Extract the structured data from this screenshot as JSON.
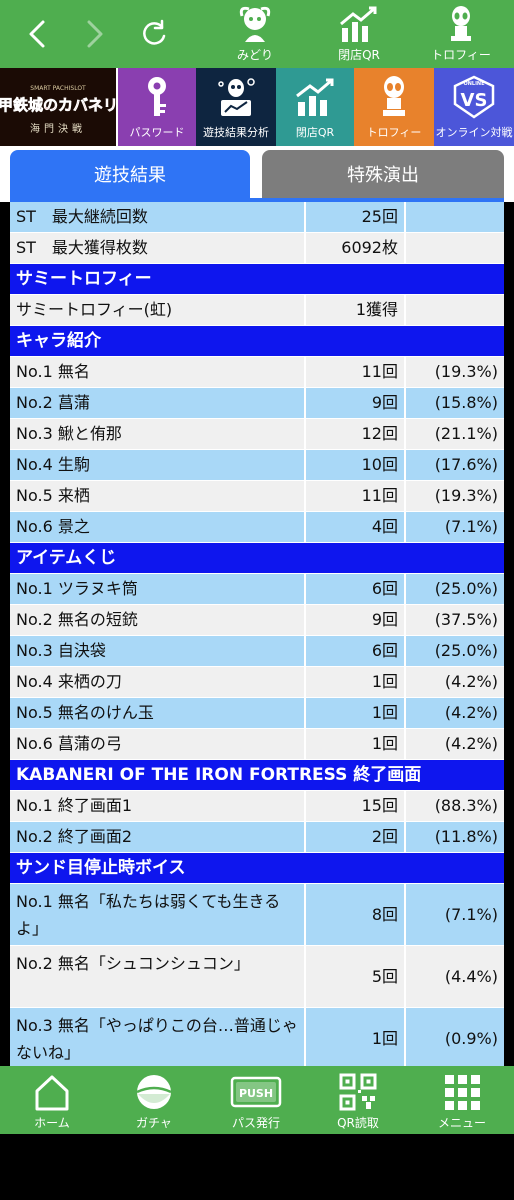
{
  "topbar": {
    "back_icon": "chevron-left-icon",
    "forward_icon": "chevron-right-icon",
    "reload_icon": "reload-icon",
    "items": [
      {
        "label": "みどり",
        "icon": "character-icon"
      },
      {
        "label": "閉店QR",
        "icon": "chart-up-icon"
      },
      {
        "label": "トロフィー",
        "icon": "alien-trophy-icon"
      }
    ]
  },
  "tiles": {
    "logo": {
      "title": "甲鉄城のカバネリ",
      "sub": "海門決戦",
      "small": "SMART PACHISLOT"
    },
    "items": [
      {
        "label": "パスワード",
        "color": "#8a3fb0",
        "icon": "key-icon"
      },
      {
        "label": "遊技結果分析",
        "color": "#0e2540",
        "icon": "analysis-icon"
      },
      {
        "label": "閉店QR",
        "color": "#2f9a93",
        "icon": "chart-up-icon"
      },
      {
        "label": "トロフィー",
        "color": "#e8822c",
        "icon": "alien-trophy-icon"
      },
      {
        "label": "オンライン対戦",
        "color": "#4c56d9",
        "icon": "vs-icon",
        "badge": "ONLINE",
        "badge_text": "VS"
      }
    ]
  },
  "tabs": {
    "active": "遊技結果",
    "inactive": "特殊演出"
  },
  "rows_top": [
    {
      "name": "ST　最大継続回数",
      "value": "25回",
      "pct": "",
      "style": "blue"
    },
    {
      "name": "ST　最大獲得枚数",
      "value": "6092枚",
      "pct": "",
      "style": "gray"
    }
  ],
  "sections": [
    {
      "title": "サミートロフィー",
      "rows": [
        {
          "name": "サミートロフィー(虹)",
          "value": "1獲得",
          "pct": "",
          "style": "gray"
        }
      ]
    },
    {
      "title": "キャラ紹介",
      "rows": [
        {
          "name": "No.1 無名",
          "value": "11回",
          "pct": "(19.3%)",
          "style": "gray"
        },
        {
          "name": "No.2 菖蒲",
          "value": "9回",
          "pct": "(15.8%)",
          "style": "blue"
        },
        {
          "name": "No.3 鰍と侑那",
          "value": "12回",
          "pct": "(21.1%)",
          "style": "gray"
        },
        {
          "name": "No.4 生駒",
          "value": "10回",
          "pct": "(17.6%)",
          "style": "blue"
        },
        {
          "name": "No.5 来栖",
          "value": "11回",
          "pct": "(19.3%)",
          "style": "gray"
        },
        {
          "name": "No.6 景之",
          "value": "4回",
          "pct": "(7.1%)",
          "style": "blue"
        }
      ]
    },
    {
      "title": "アイテムくじ",
      "rows": [
        {
          "name": "No.1 ツラヌキ筒",
          "value": "6回",
          "pct": "(25.0%)",
          "style": "blue"
        },
        {
          "name": "No.2 無名の短銃",
          "value": "9回",
          "pct": "(37.5%)",
          "style": "gray"
        },
        {
          "name": "No.3 自決袋",
          "value": "6回",
          "pct": "(25.0%)",
          "style": "blue"
        },
        {
          "name": "No.4 来栖の刀",
          "value": "1回",
          "pct": "(4.2%)",
          "style": "gray"
        },
        {
          "name": "No.5 無名のけん玉",
          "value": "1回",
          "pct": "(4.2%)",
          "style": "blue"
        },
        {
          "name": "No.6 菖蒲の弓",
          "value": "1回",
          "pct": "(4.2%)",
          "style": "gray"
        }
      ]
    },
    {
      "title": "KABANERI OF THE IRON FORTRESS 終了画面",
      "rows": [
        {
          "name": "No.1 終了画面1",
          "value": "15回",
          "pct": "(88.3%)",
          "style": "gray"
        },
        {
          "name": "No.2 終了画面2",
          "value": "2回",
          "pct": "(11.8%)",
          "style": "blue"
        }
      ]
    },
    {
      "title": "サンド目停止時ボイス",
      "rows": [
        {
          "name": "No.1 無名「私たちは弱くても生きるよ」",
          "value": "8回",
          "pct": "(7.1%)",
          "style": "blue",
          "tall": true
        },
        {
          "name": "No.2 無名「シュコンシュコン」",
          "value": "5回",
          "pct": "(4.4%)",
          "style": "gray",
          "tall": true
        },
        {
          "name": "No.3 無名「やっぱりこの台…普通じゃないね」",
          "value": "1回",
          "pct": "(0.9%)",
          "style": "blue",
          "tall": true
        }
      ]
    }
  ],
  "bottomnav": [
    {
      "label": "ホーム",
      "icon": "home-icon"
    },
    {
      "label": "ガチャ",
      "icon": "gacha-icon"
    },
    {
      "label": "パス発行",
      "icon": "push-pass-icon",
      "badge_text": "PUSH"
    },
    {
      "label": "QR読取",
      "icon": "qr-icon"
    },
    {
      "label": "メニュー",
      "icon": "grid-menu-icon"
    }
  ]
}
